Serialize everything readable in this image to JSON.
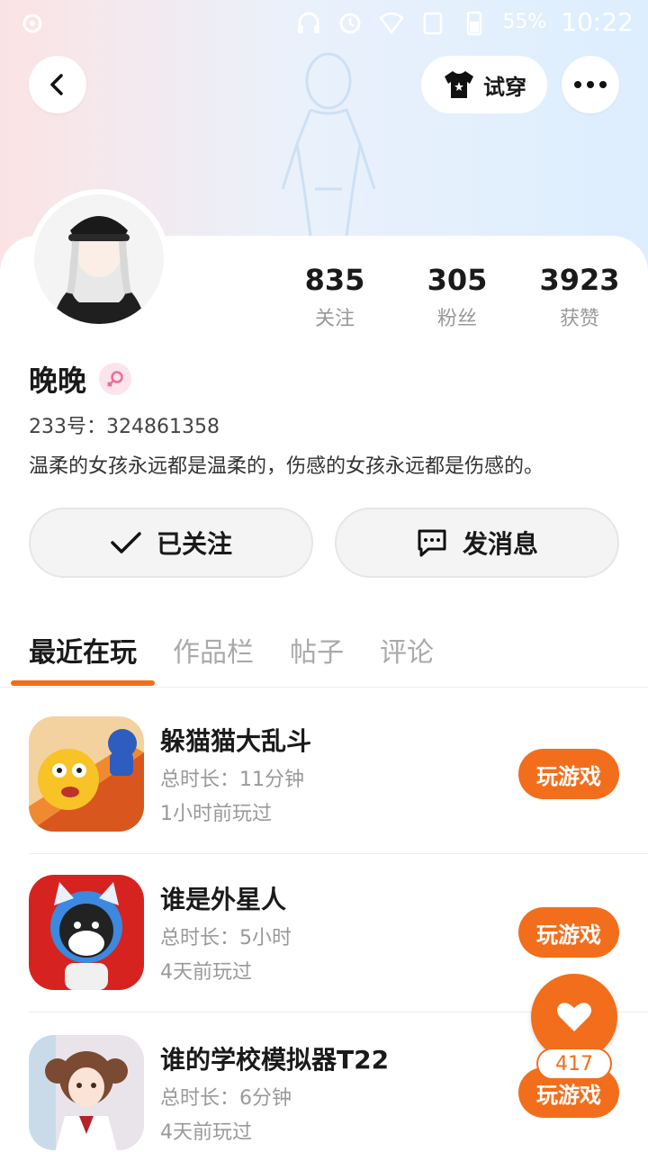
{
  "status_bar": {
    "battery": "55%",
    "time": "10:22"
  },
  "header": {
    "tryon_label": "试穿"
  },
  "profile": {
    "name": "晚晚",
    "uid": "233号：324861358",
    "bio": "温柔的女孩永远都是温柔的，伤感的女孩永远都是伤感的。",
    "stats": [
      {
        "value": "835",
        "label": "关注"
      },
      {
        "value": "305",
        "label": "粉丝"
      },
      {
        "value": "3923",
        "label": "获赞"
      }
    ]
  },
  "actions": {
    "follow_label": "已关注",
    "message_label": "发消息"
  },
  "tabs": [
    "最近在玩",
    "作品栏",
    "帖子",
    "评论"
  ],
  "games": [
    {
      "title": "躲猫猫大乱斗",
      "duration": "总时长：11分钟",
      "last_played": "1小时前玩过",
      "play_label": "玩游戏"
    },
    {
      "title": "谁是外星人",
      "duration": "总时长：5小时",
      "last_played": "4天前玩过",
      "play_label": "玩游戏"
    },
    {
      "title": "谁的学校模拟器T22",
      "duration": "总时长：6分钟",
      "last_played": "4天前玩过",
      "play_label": "玩游戏"
    }
  ],
  "like": {
    "count": "417"
  },
  "colors": {
    "accent": "#f26e1c"
  }
}
